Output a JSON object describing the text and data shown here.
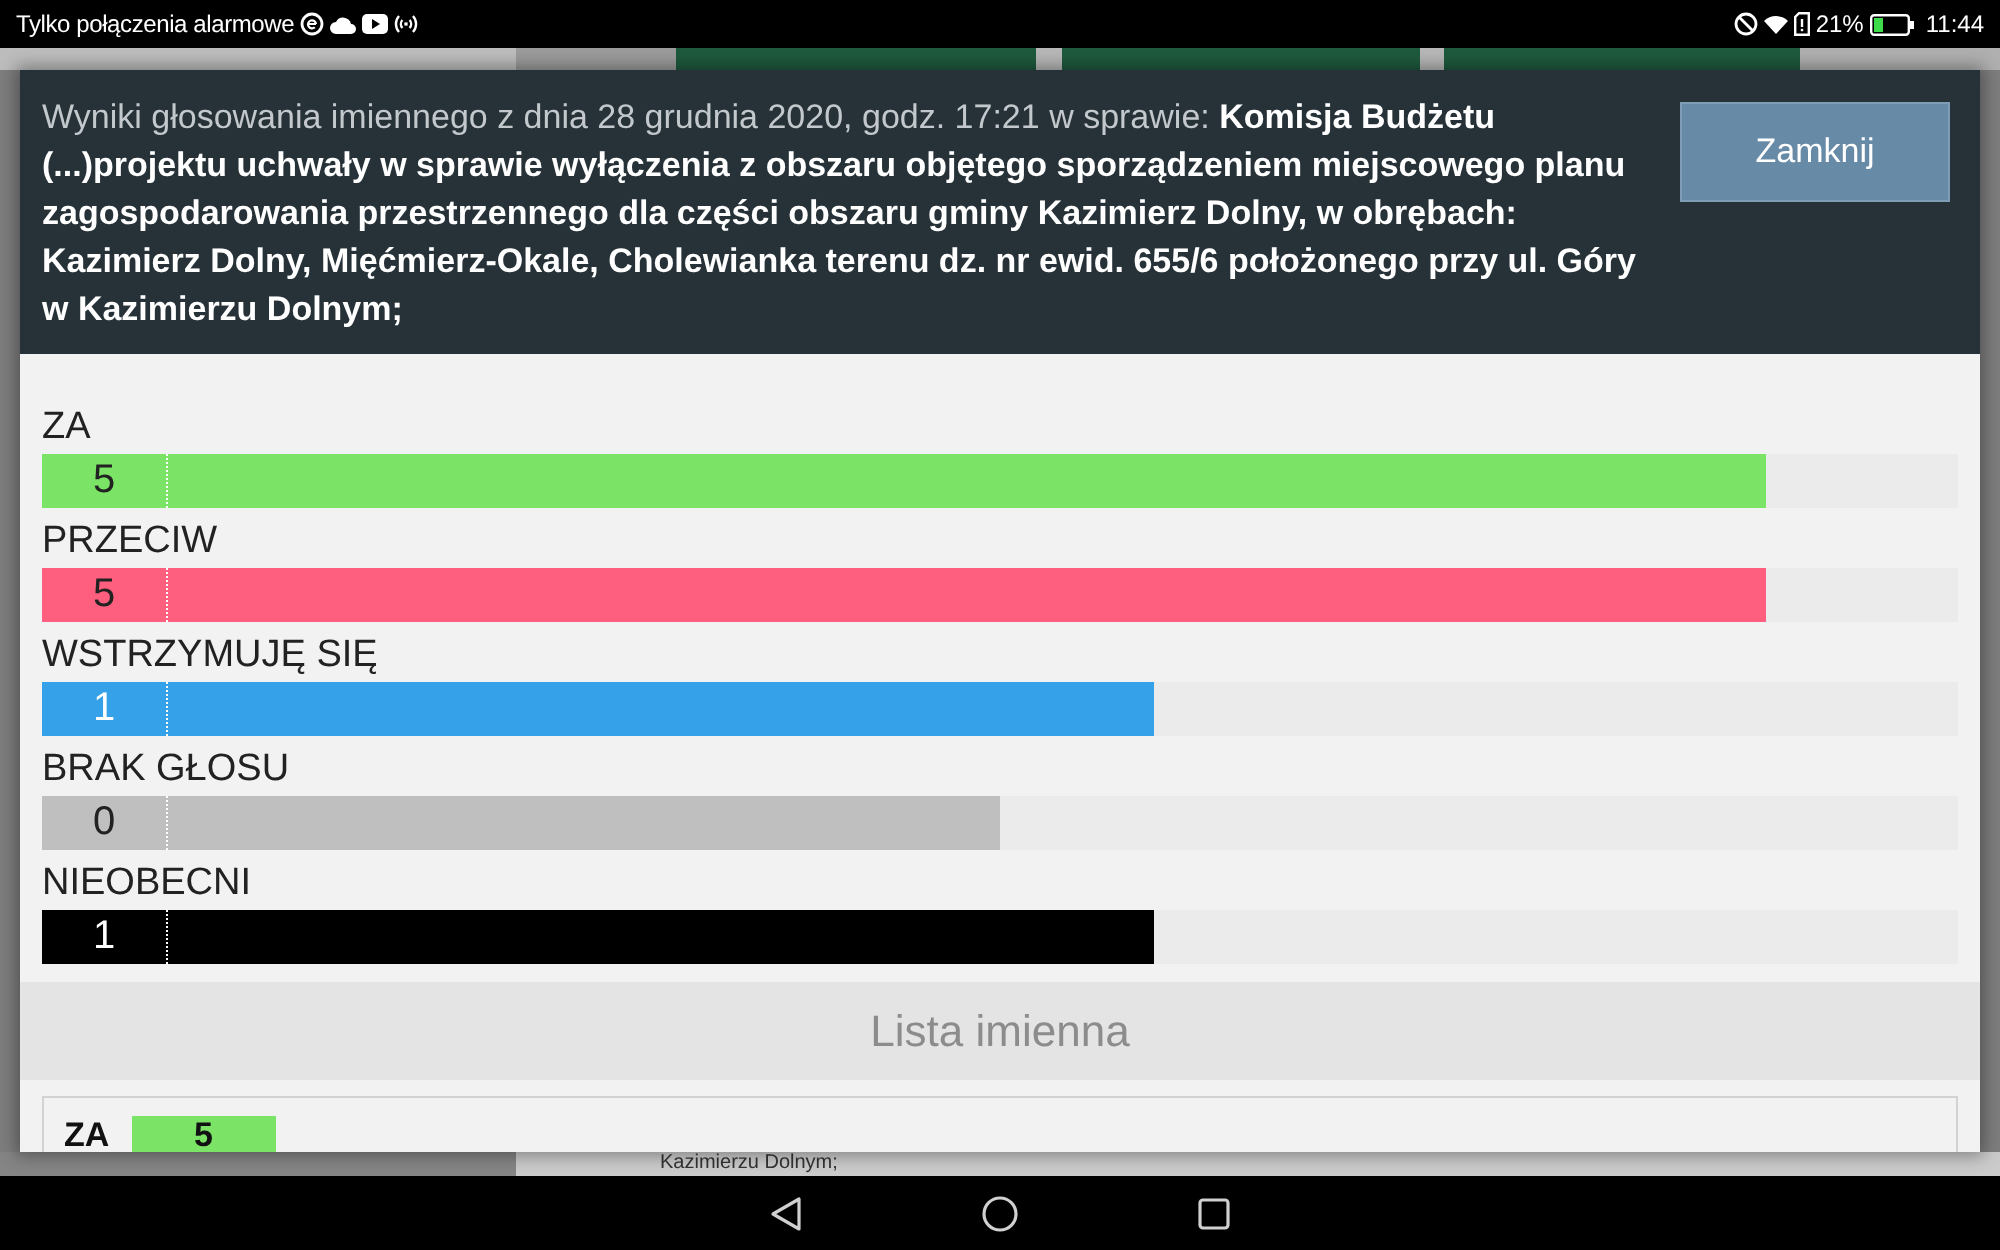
{
  "status_bar": {
    "network_text": "Tylko połączenia alarmowe",
    "battery_text": "21%",
    "time": "11:44"
  },
  "background": {
    "partial_text": "Kazimierzu Dolnym;"
  },
  "dialog": {
    "title": "Wyniki głosowania imiennego z dnia 28 grudnia 2020, godz. 17:21 w sprawie: **Komisja Budżetu (...)projektu uchwały w sprawie wyłączenia z obszaru objętego sporządzeniem miejscowego planu zagospodarowania przestrzennego dla części obszaru gminy Kazimierz Dolny, w obrębach: Kazimierz Dolny, Mięćmierz-Okale, Cholewianka terenu dz. nr ewid. 655/6 położonego przy ul. Góry w Kazimierzu Dolnym;**",
    "close_button": "Zamknij",
    "results": [
      {
        "label": "ZA",
        "count": "5",
        "level": 0.9,
        "color": "#7be366"
      },
      {
        "label": "PRZECIW",
        "count": "5",
        "level": 0.9,
        "color": "#ff5f7f"
      },
      {
        "label": "WSTRZYMUJĘ SIĘ",
        "count": "1",
        "level": 0.58,
        "color": "#35a1e9"
      },
      {
        "label": "BRAK GŁOSU",
        "count": "0",
        "level": 0.5,
        "color": "#bfbfbf"
      },
      {
        "label": "NIEOBECNI",
        "count": "1",
        "level": 0.58,
        "color": "#000000"
      }
    ],
    "named_list": {
      "title": "Lista imienna",
      "groups": [
        {
          "label": "ZA",
          "count": "5",
          "color": "#7be366"
        }
      ]
    }
  }
}
